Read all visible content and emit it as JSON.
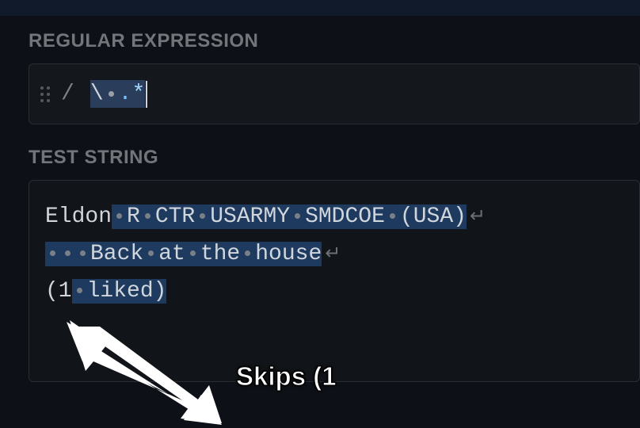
{
  "labels": {
    "regex_section": "REGULAR EXPRESSION",
    "test_section": "TEST STRING"
  },
  "regex": {
    "delimiter": "/",
    "pattern_escape": "\\",
    "pattern_dot": ".",
    "pattern_star": "*"
  },
  "test": {
    "line1_pre": "Eldon",
    "line1_match": "R CTR USARMY SMDCOE (USA)",
    "line2_leading_spaces": 3,
    "line2_match_text": "Back at the house",
    "line3_pre": "(1",
    "line3_match": "liked)"
  },
  "annotation": {
    "text": "Skips (1"
  }
}
